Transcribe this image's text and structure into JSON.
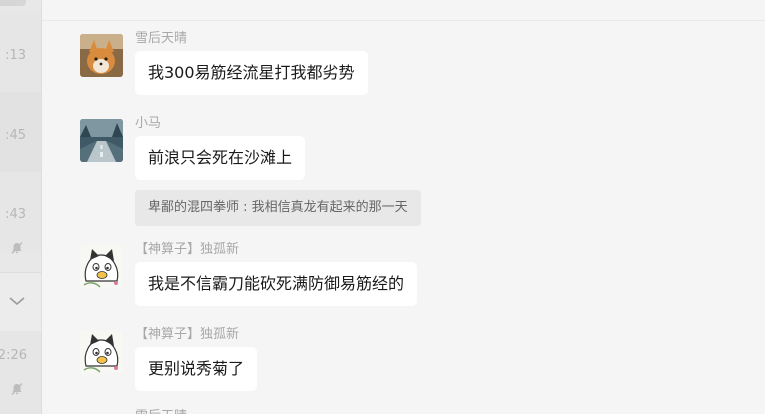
{
  "session_list": {
    "times": [
      ":13",
      ":45",
      ":43",
      "2:26"
    ]
  },
  "messages": [
    {
      "sender": "雪后天晴",
      "text": "我300易筋经流星打我都劣势",
      "avatar": "fox-avatar"
    },
    {
      "sender": "小马",
      "text": "前浪只会死在沙滩上",
      "avatar": "road-avatar"
    },
    {
      "sender": "【神算子】独孤新",
      "text": "我是不信霸刀能砍死满防御易筋经的",
      "avatar": "cartoon-cat-avatar"
    },
    {
      "sender": "【神算子】独孤新",
      "text": "更别说秀菊了",
      "avatar": "cartoon-cat-avatar"
    }
  ],
  "quote": {
    "text": "卑鄙的混四拳师 : 我相信真龙有起来的那一天"
  },
  "next_sender_cut": "雪后天晴",
  "colors": {
    "bubble": "#ffffff",
    "chat_bg": "#f5f5f5",
    "sender": "#a8a8a8"
  }
}
